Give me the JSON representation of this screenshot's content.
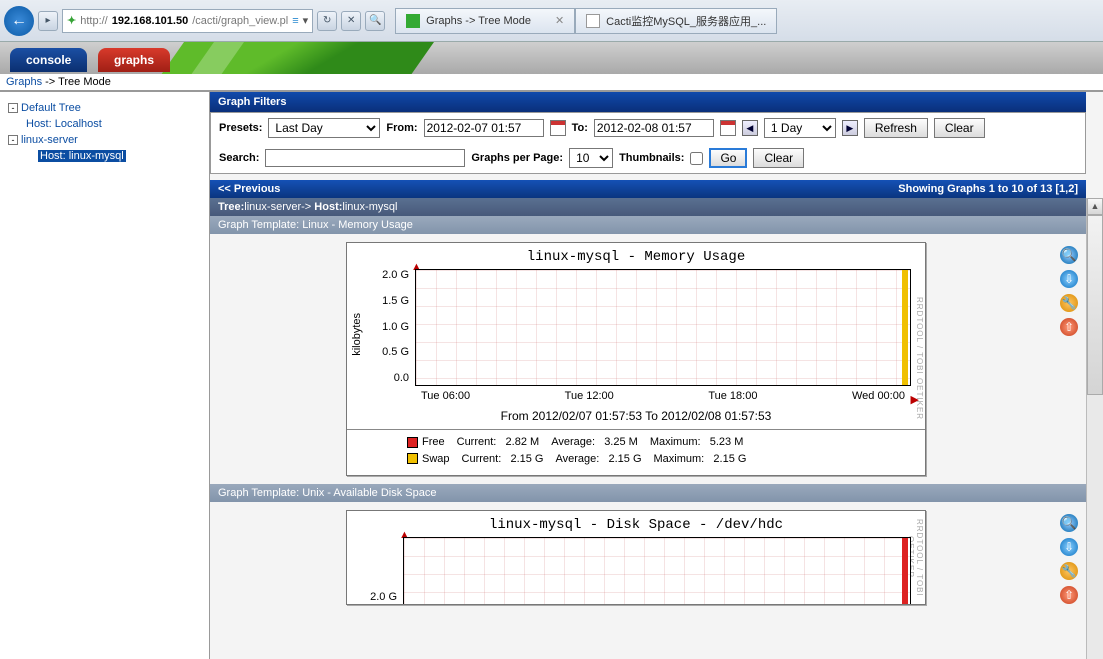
{
  "browser": {
    "url_prefix": "http://",
    "url_host": "192.168.101.50",
    "url_path": "/cacti/graph_view.pl",
    "tab1_label": "Graphs -> Tree Mode",
    "tab2_label": "Cacti监控MySQL_服务器应用_..."
  },
  "top_tabs": {
    "console": "console",
    "graphs": "graphs"
  },
  "breadcrumb": {
    "root": "Graphs",
    "sep": "-> Tree Mode"
  },
  "tree": {
    "default_tree": "Default Tree",
    "host_localhost": "Host: Localhost",
    "linux_server": "linux-server",
    "host_linux_mysql": "Host: linux-mysql"
  },
  "filters": {
    "title": "Graph Filters",
    "presets_label": "Presets:",
    "presets_value": "Last Day",
    "from_label": "From:",
    "from_value": "2012-02-07 01:57",
    "to_label": "To:",
    "to_value": "2012-02-08 01:57",
    "shift_value": "1 Day",
    "refresh": "Refresh",
    "clear": "Clear",
    "search_label": "Search:",
    "gpp_label": "Graphs per Page:",
    "gpp_value": "10",
    "thumb_label": "Thumbnails:",
    "go": "Go",
    "clear2": "Clear"
  },
  "navbar": {
    "prev": "<< Previous",
    "showing": "Showing Graphs 1 to 10 of 13 [",
    "p1": "1",
    "p2": ",2]"
  },
  "context": {
    "tree_lbl": "Tree:",
    "tree_val": "linux-server-> ",
    "host_lbl": "Host:",
    "host_val": "linux-mysql"
  },
  "templates": {
    "mem": {
      "label": "Graph Template:",
      "name": "Linux - Memory Usage"
    },
    "disk": {
      "label": "Graph Template:",
      "name": "Unix - Available Disk Space"
    }
  },
  "chart_data": [
    {
      "type": "area",
      "title": "linux-mysql - Memory Usage",
      "ylabel": "kilobytes",
      "yticks": [
        "2.0 G",
        "1.5 G",
        "1.0 G",
        "0.5 G",
        "0.0"
      ],
      "ylim": [
        0,
        2.2
      ],
      "xticks": [
        "Tue 06:00",
        "Tue 12:00",
        "Tue 18:00",
        "Wed 00:00"
      ],
      "caption": "From 2012/02/07 01:57:53 To 2012/02/08 01:57:53",
      "series": [
        {
          "name": "Free",
          "color": "#d22",
          "current": "2.82 M",
          "average": "3.25 M",
          "maximum": "5.23 M"
        },
        {
          "name": "Swap",
          "color": "#f0c000",
          "current": "2.15 G",
          "average": "2.15 G",
          "maximum": "2.15 G"
        }
      ],
      "legend_cols": [
        "Current:",
        "Average:",
        "Maximum:"
      ]
    },
    {
      "type": "area",
      "title": "linux-mysql - Disk Space - /dev/hdc",
      "ylabel": "",
      "yticks": [
        "2.0 G"
      ],
      "ylim": [
        0,
        2.2
      ],
      "xticks": [],
      "caption": "",
      "series": [],
      "legend_cols": []
    }
  ],
  "rrd_watermark": "RRDTOOL / TOBI OETIKER"
}
